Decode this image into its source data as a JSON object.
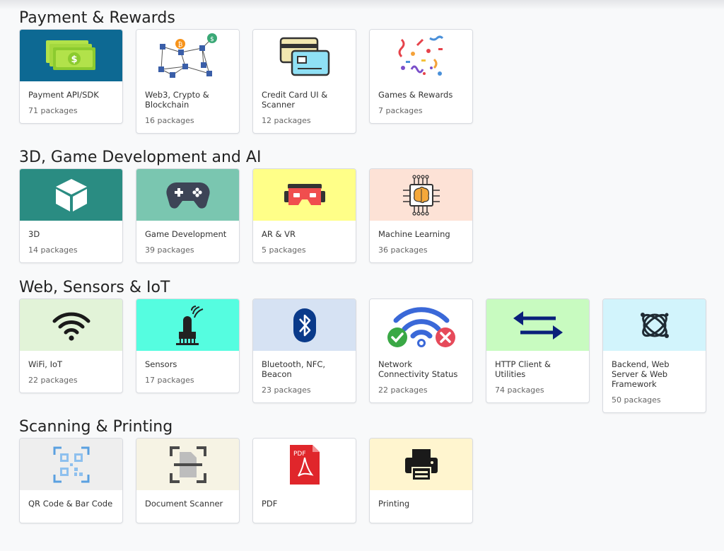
{
  "sections": [
    {
      "title": "Payment & Rewards",
      "cards": [
        {
          "title": "Payment API/SDK",
          "count": "71 packages",
          "icon": "money-icon",
          "bg": "#0d6993"
        },
        {
          "title": "Web3, Crypto & Blockchain",
          "count": "16 packages",
          "icon": "blockchain-icon",
          "bg": "#ffffff"
        },
        {
          "title": "Credit Card UI & Scanner",
          "count": "12 packages",
          "icon": "credit-card-icon",
          "bg": "#ffffff"
        },
        {
          "title": "Games & Rewards",
          "count": "7 packages",
          "icon": "confetti-icon",
          "bg": "#ffffff"
        }
      ]
    },
    {
      "title": "3D, Game Development and AI",
      "cards": [
        {
          "title": "3D",
          "count": "14 packages",
          "icon": "cube-icon",
          "bg": "#2a8c82"
        },
        {
          "title": "Game Development",
          "count": "39 packages",
          "icon": "gamepad-icon",
          "bg": "#7ac6b0"
        },
        {
          "title": "AR & VR",
          "count": "5 packages",
          "icon": "vr-headset-icon",
          "bg": "#ffff88"
        },
        {
          "title": "Machine Learning",
          "count": "36 packages",
          "icon": "brain-chip-icon",
          "bg": "#fde2d6"
        }
      ]
    },
    {
      "title": "Web, Sensors & IoT",
      "cards": [
        {
          "title": "WiFi, IoT",
          "count": "22 packages",
          "icon": "wifi-icon",
          "bg": "#e2f3d8"
        },
        {
          "title": "Sensors",
          "count": "17 packages",
          "icon": "sensor-icon",
          "bg": "#55fde0"
        },
        {
          "title": "Bluetooth, NFC, Beacon",
          "count": "23 packages",
          "icon": "bluetooth-icon",
          "bg": "#d6e2f3"
        },
        {
          "title": "Network Connectivity Status",
          "count": "22 packages",
          "icon": "network-status-icon",
          "bg": "#ffffff"
        },
        {
          "title": "HTTP Client & Utilities",
          "count": "74 packages",
          "icon": "transfer-arrows-icon",
          "bg": "#c8fbc0"
        },
        {
          "title": "Backend, Web Server & Web Framework",
          "count": "50 packages",
          "icon": "server-globe-icon",
          "bg": "#d2f4fc"
        }
      ]
    },
    {
      "title": "Scanning & Printing",
      "cards": [
        {
          "title": "QR Code & Bar Code",
          "count": "",
          "icon": "qr-code-icon",
          "bg": "#eeeeee"
        },
        {
          "title": "Document Scanner",
          "count": "",
          "icon": "document-scanner-icon",
          "bg": "#f6f3e4"
        },
        {
          "title": "PDF",
          "count": "",
          "icon": "pdf-icon",
          "bg": "#ffffff"
        },
        {
          "title": "Printing",
          "count": "",
          "icon": "printer-icon",
          "bg": "#fff5cf"
        }
      ]
    }
  ]
}
